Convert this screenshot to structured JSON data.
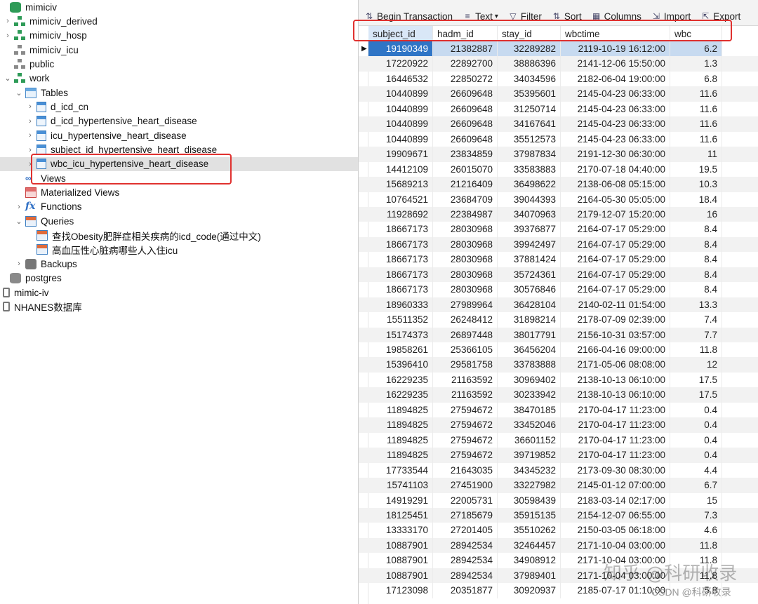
{
  "tree": {
    "items": [
      {
        "label": "mimiciv",
        "indent": 0,
        "expander": "",
        "icon": "database-icon",
        "cls": "ico-db"
      },
      {
        "label": "mimiciv_derived",
        "indent": 1,
        "expander": "›",
        "icon": "schema-icon",
        "cls": "ico-schema-green"
      },
      {
        "label": "mimiciv_hosp",
        "indent": 1,
        "expander": "›",
        "icon": "schema-icon",
        "cls": "ico-schema-green"
      },
      {
        "label": "mimiciv_icu",
        "indent": 1,
        "expander": "",
        "icon": "schema-icon",
        "cls": "ico-schema-grey"
      },
      {
        "label": "public",
        "indent": 1,
        "expander": "",
        "icon": "schema-icon",
        "cls": "ico-schema-grey"
      },
      {
        "label": "work",
        "indent": 1,
        "expander": "⌄",
        "icon": "schema-icon",
        "cls": "ico-schema-green"
      },
      {
        "label": "Tables",
        "indent": 2,
        "expander": "⌄",
        "icon": "tables-icon",
        "cls": "ico-tables"
      },
      {
        "label": "d_icd_cn",
        "indent": 3,
        "expander": "›",
        "icon": "table-icon",
        "cls": "ico-table"
      },
      {
        "label": "d_icd_hypertensive_heart_disease",
        "indent": 3,
        "expander": "›",
        "icon": "table-icon",
        "cls": "ico-table"
      },
      {
        "label": "icu_hypertensive_heart_disease",
        "indent": 3,
        "expander": "›",
        "icon": "table-icon",
        "cls": "ico-table"
      },
      {
        "label": "subject_id_hypertensive_heart_disease",
        "indent": 3,
        "expander": "›",
        "icon": "table-icon",
        "cls": "ico-table"
      },
      {
        "label": "wbc_icu_hypertensive_heart_disease",
        "indent": 3,
        "expander": "›",
        "icon": "table-icon",
        "cls": "ico-table",
        "selected": true
      },
      {
        "label": "Views",
        "indent": 2,
        "expander": "",
        "icon": "views-icon",
        "cls": "ico-views"
      },
      {
        "label": "Materialized Views",
        "indent": 2,
        "expander": "",
        "icon": "materialized-views-icon",
        "cls": "ico-mviews"
      },
      {
        "label": "Functions",
        "indent": 2,
        "expander": "›",
        "icon": "functions-icon",
        "cls": "ico-func"
      },
      {
        "label": "Queries",
        "indent": 2,
        "expander": "⌄",
        "icon": "queries-icon",
        "cls": "ico-query"
      },
      {
        "label": "查找Obesity肥胖症相关疾病的icd_code(通过中文)",
        "indent": 3,
        "expander": "",
        "icon": "query-icon",
        "cls": "ico-query"
      },
      {
        "label": "高血压性心脏病哪些人入住icu",
        "indent": 3,
        "expander": "",
        "icon": "query-icon",
        "cls": "ico-query"
      },
      {
        "label": "Backups",
        "indent": 2,
        "expander": "›",
        "icon": "backup-icon",
        "cls": "ico-backup"
      },
      {
        "label": "postgres",
        "indent": 0,
        "expander": "",
        "icon": "database-icon",
        "cls": "ico-db-grey"
      },
      {
        "label": "mimic-iv",
        "indent": -1,
        "expander": "",
        "icon": "connection-icon",
        "cls": "ico-conn"
      },
      {
        "label": "NHANES数据库",
        "indent": -1,
        "expander": "",
        "icon": "connection-icon",
        "cls": "ico-conn"
      }
    ]
  },
  "toolbar": {
    "buttons": [
      {
        "label": "Begin Transaction",
        "icon": "transaction-icon",
        "glyph": "⇅"
      },
      {
        "label": "Text",
        "icon": "text-icon",
        "glyph": "≡",
        "dropdown": "▾"
      },
      {
        "label": "Filter",
        "icon": "filter-icon",
        "glyph": "▽"
      },
      {
        "label": "Sort",
        "icon": "sort-icon",
        "glyph": "⇅"
      },
      {
        "label": "Columns",
        "icon": "columns-icon",
        "glyph": "▦"
      },
      {
        "label": "Import",
        "icon": "import-icon",
        "glyph": "⇲"
      },
      {
        "label": "Export",
        "icon": "export-icon",
        "glyph": "⇱"
      }
    ]
  },
  "grid": {
    "columns": [
      "subject_id",
      "hadm_id",
      "stay_id",
      "wbctime",
      "wbc"
    ],
    "rows": [
      [
        "19190349",
        "21382887",
        "32289282",
        "2119-10-19 16:12:00",
        "6.2"
      ],
      [
        "17220922",
        "22892700",
        "38886396",
        "2141-12-06 15:50:00",
        "1.3"
      ],
      [
        "16446532",
        "22850272",
        "34034596",
        "2182-06-04 19:00:00",
        "6.8"
      ],
      [
        "10440899",
        "26609648",
        "35395601",
        "2145-04-23 06:33:00",
        "11.6"
      ],
      [
        "10440899",
        "26609648",
        "31250714",
        "2145-04-23 06:33:00",
        "11.6"
      ],
      [
        "10440899",
        "26609648",
        "34167641",
        "2145-04-23 06:33:00",
        "11.6"
      ],
      [
        "10440899",
        "26609648",
        "35512573",
        "2145-04-23 06:33:00",
        "11.6"
      ],
      [
        "19909671",
        "23834859",
        "37987834",
        "2191-12-30 06:30:00",
        "11"
      ],
      [
        "14412109",
        "26015070",
        "33583883",
        "2170-07-18 04:40:00",
        "19.5"
      ],
      [
        "15689213",
        "21216409",
        "36498622",
        "2138-06-08 05:15:00",
        "10.3"
      ],
      [
        "10764521",
        "23684709",
        "39044393",
        "2164-05-30 05:05:00",
        "18.4"
      ],
      [
        "11928692",
        "22384987",
        "34070963",
        "2179-12-07 15:20:00",
        "16"
      ],
      [
        "18667173",
        "28030968",
        "39376877",
        "2164-07-17 05:29:00",
        "8.4"
      ],
      [
        "18667173",
        "28030968",
        "39942497",
        "2164-07-17 05:29:00",
        "8.4"
      ],
      [
        "18667173",
        "28030968",
        "37881424",
        "2164-07-17 05:29:00",
        "8.4"
      ],
      [
        "18667173",
        "28030968",
        "35724361",
        "2164-07-17 05:29:00",
        "8.4"
      ],
      [
        "18667173",
        "28030968",
        "30576846",
        "2164-07-17 05:29:00",
        "8.4"
      ],
      [
        "18960333",
        "27989964",
        "36428104",
        "2140-02-11 01:54:00",
        "13.3"
      ],
      [
        "15511352",
        "26248412",
        "31898214",
        "2178-07-09 02:39:00",
        "7.4"
      ],
      [
        "15174373",
        "26897448",
        "38017791",
        "2156-10-31 03:57:00",
        "7.7"
      ],
      [
        "19858261",
        "25366105",
        "36456204",
        "2166-04-16 09:00:00",
        "11.8"
      ],
      [
        "15396410",
        "29581758",
        "33783888",
        "2171-05-06 08:08:00",
        "12"
      ],
      [
        "16229235",
        "21163592",
        "30969402",
        "2138-10-13 06:10:00",
        "17.5"
      ],
      [
        "16229235",
        "21163592",
        "30233942",
        "2138-10-13 06:10:00",
        "17.5"
      ],
      [
        "11894825",
        "27594672",
        "38470185",
        "2170-04-17 11:23:00",
        "0.4"
      ],
      [
        "11894825",
        "27594672",
        "33452046",
        "2170-04-17 11:23:00",
        "0.4"
      ],
      [
        "11894825",
        "27594672",
        "36601152",
        "2170-04-17 11:23:00",
        "0.4"
      ],
      [
        "11894825",
        "27594672",
        "39719852",
        "2170-04-17 11:23:00",
        "0.4"
      ],
      [
        "17733544",
        "21643035",
        "34345232",
        "2173-09-30 08:30:00",
        "4.4"
      ],
      [
        "15741103",
        "27451900",
        "33227982",
        "2145-01-12 07:00:00",
        "6.7"
      ],
      [
        "14919291",
        "22005731",
        "30598439",
        "2183-03-14 02:17:00",
        "15"
      ],
      [
        "18125451",
        "27185679",
        "35915135",
        "2154-12-07 06:55:00",
        "7.3"
      ],
      [
        "13333170",
        "27201405",
        "35510262",
        "2150-03-05 06:18:00",
        "4.6"
      ],
      [
        "10887901",
        "28942534",
        "32464457",
        "2171-10-04 03:00:00",
        "11.8"
      ],
      [
        "10887901",
        "28942534",
        "34908912",
        "2171-10-04 03:00:00",
        "11.8"
      ],
      [
        "10887901",
        "28942534",
        "37989401",
        "2171-10-04 03:00:00",
        "11.8"
      ],
      [
        "17123098",
        "20351877",
        "30920937",
        "2185-07-17 01:10:00",
        "5.8"
      ]
    ]
  },
  "watermark": {
    "text": "知乎 @科研收录",
    "csdn": "CSDN @科研收录"
  },
  "colors": {
    "highlight": "#e0312f",
    "selection": "#2f75c6",
    "accent_green": "#2e9b57"
  }
}
